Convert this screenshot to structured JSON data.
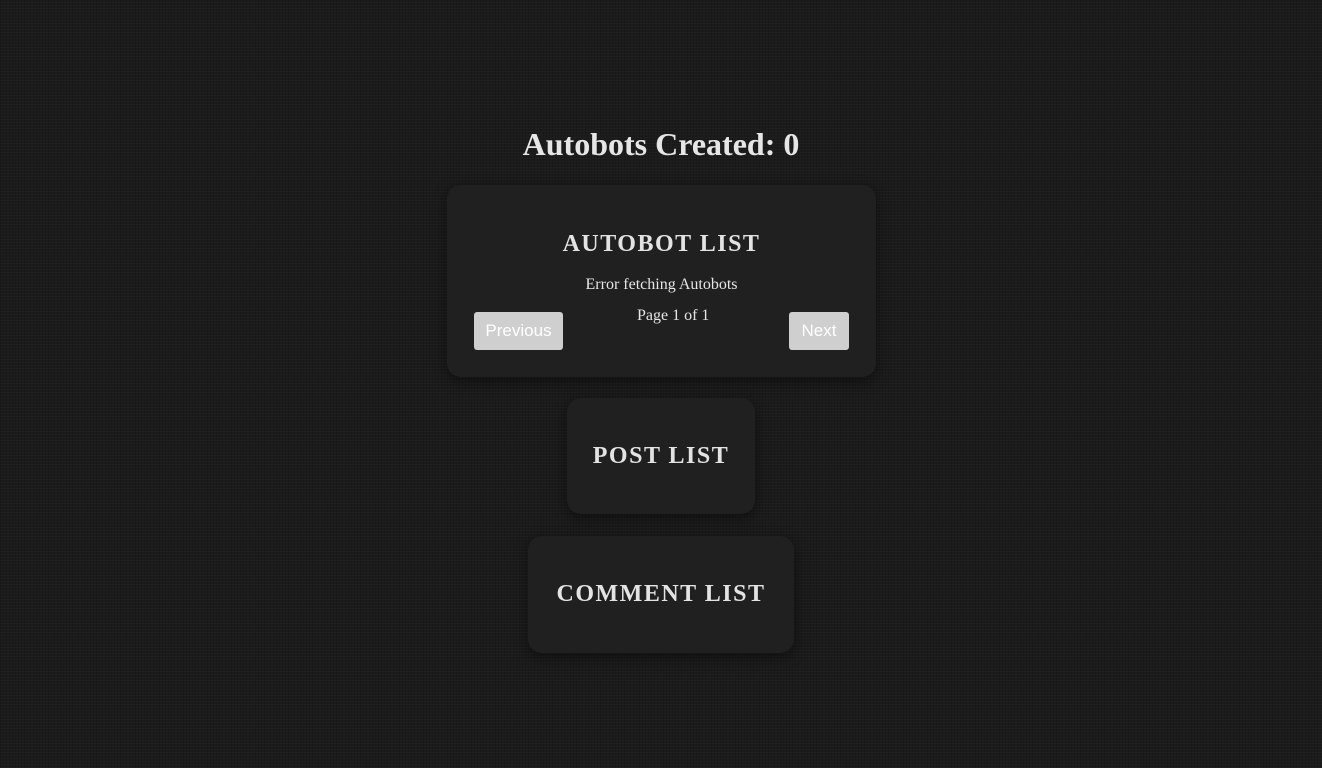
{
  "header": {
    "title": "Autobots Created: 0"
  },
  "autobot_list": {
    "heading": "AUTOBOT LIST",
    "error": "Error fetching Autobots",
    "page_indicator": "Page 1 of 1",
    "previous_label": "Previous",
    "next_label": "Next"
  },
  "post_list": {
    "heading": "POST LIST"
  },
  "comment_list": {
    "heading": "COMMENT LIST"
  }
}
